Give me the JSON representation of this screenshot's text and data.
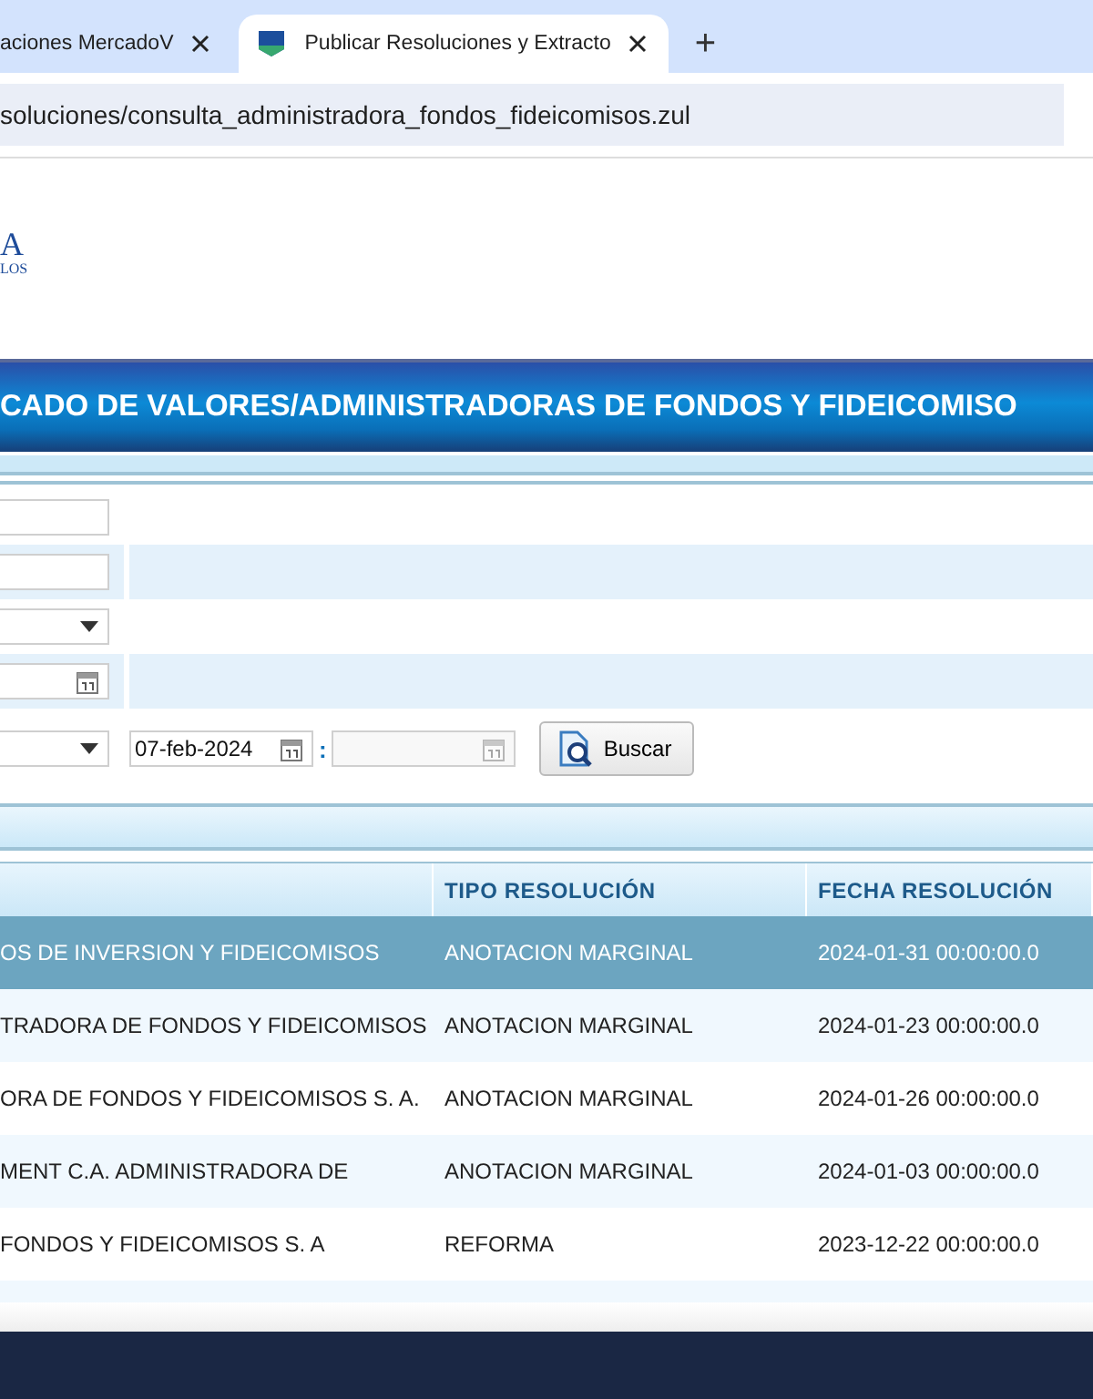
{
  "browser": {
    "tabs": [
      {
        "title": "aciones MercadoV",
        "selected": false
      },
      {
        "title": "Publicar Resoluciones y Extracto",
        "selected": true
      }
    ],
    "new_tab": "+",
    "address": "soluciones/consulta_administradora_fondos_fideicomisos.zul"
  },
  "logo": {
    "line_1": "A",
    "line_2": "LOS"
  },
  "banner": "CADO DE VALORES/ADMINISTRADORAS DE FONDOS Y FIDEICOMISO",
  "form": {
    "rows": [
      {
        "shaded": false,
        "fields": [
          {
            "kind": "text"
          }
        ]
      },
      {
        "shaded": true,
        "fields": [
          {
            "kind": "text"
          }
        ]
      },
      {
        "shaded": false,
        "fields": [
          {
            "kind": "select"
          }
        ]
      },
      {
        "shaded": true,
        "fields": [
          {
            "kind": "date",
            "disabled": false
          }
        ]
      },
      {
        "shaded": false,
        "fields": [
          {
            "kind": "select"
          },
          {
            "kind": "date",
            "value": "07-feb-2024",
            "disabled": false
          },
          {
            "kind": "separator",
            "text": ":"
          },
          {
            "kind": "date",
            "disabled": true
          },
          {
            "kind": "button",
            "label": "Buscar"
          }
        ]
      }
    ]
  },
  "table": {
    "columns": [
      "",
      "TIPO RESOLUCIÓN",
      "FECHA RESOLUCIÓN"
    ],
    "rows": [
      {
        "cells": [
          "OS DE INVERSION Y FIDEICOMISOS",
          "ANOTACION MARGINAL",
          "2024-01-31 00:00:00.0"
        ],
        "selected": true
      },
      {
        "cells": [
          "TRADORA DE FONDOS Y FIDEICOMISOS",
          "ANOTACION MARGINAL",
          "2024-01-23 00:00:00.0"
        ],
        "selected": false
      },
      {
        "cells": [
          "ORA DE FONDOS Y FIDEICOMISOS S. A.",
          "ANOTACION MARGINAL",
          "2024-01-26 00:00:00.0"
        ],
        "selected": false
      },
      {
        "cells": [
          "MENT C.A. ADMINISTRADORA DE",
          "ANOTACION MARGINAL",
          "2024-01-03 00:00:00.0"
        ],
        "selected": false
      },
      {
        "cells": [
          "FONDOS Y FIDEICOMISOS S. A",
          "REFORMA",
          "2023-12-22 00:00:00.0"
        ],
        "selected": false
      }
    ]
  }
}
